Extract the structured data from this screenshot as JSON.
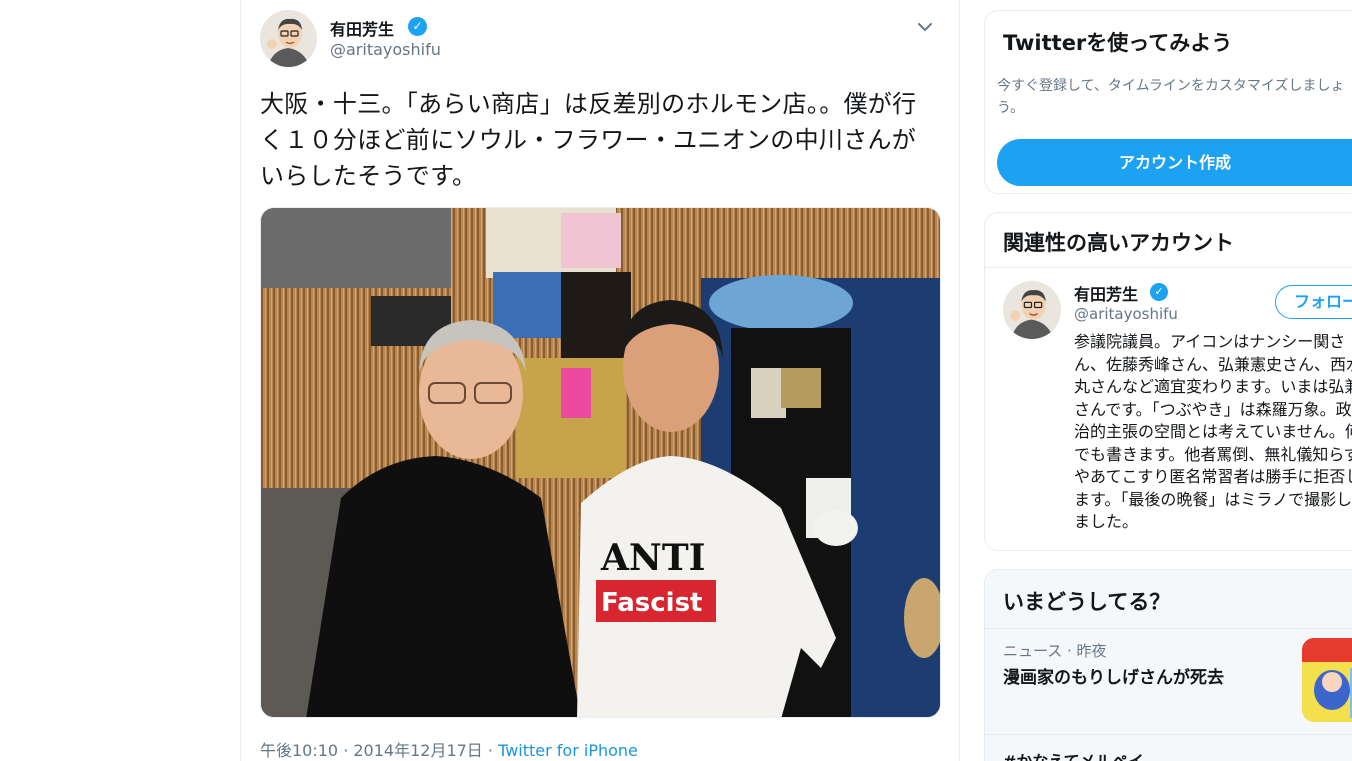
{
  "tweet": {
    "author_name": "有田芳生",
    "author_handle": "@aritayoshifu",
    "verified_glyph": "✓",
    "text": "大阪・十三。「あらい商店」は反差別のホルモン店。。僕が行く１０分ほど前にソウル・フラワー・ユニオンの中川さんがいらしたそうです。",
    "timestamp": "午後10:10 · 2014年12月17日 · ",
    "source": "Twitter for iPhone",
    "photo": {
      "shirt_line1": "ANTI",
      "shirt_line2": "Fascist"
    }
  },
  "signup_card": {
    "title": "Twitterを使ってみよう",
    "description": "今すぐ登録して、タイムラインをカスタマイズしましょう。",
    "button": "アカウント作成"
  },
  "related_card": {
    "title": "関連性の高いアカウント",
    "account": {
      "name": "有田芳生",
      "handle": "@aritayoshifu",
      "follow_label": "フォロー",
      "bio": "参議院議員。アイコンはナンシー関さん、佐藤秀峰さん、弘兼憲史さん、西水丸さんなど適宜変わります。いまは弘兼さんです。「つぶやき」は森羅万象。政治的主張の空間とは考えていません。何でも書きます。他者罵倒、無礼儀知らずやあてこすり匿名常習者は勝手に拒否します。「最後の晩餐」はミラノで撮影しました。"
    }
  },
  "trends_card": {
    "title": "いまどうしてる？",
    "item1_meta": "ニュース · 昨夜",
    "item1_title": "漫画家のもりしげさんが死去",
    "item2_title": "#かなえてメルペイ"
  },
  "colors": {
    "accent": "#1da1f2",
    "link": "#1b95e0",
    "secondary_text": "#657786",
    "border": "#e6ecf0"
  },
  "icons": {
    "verified": "verified-badge-icon",
    "caret": "chevron-down-icon"
  }
}
